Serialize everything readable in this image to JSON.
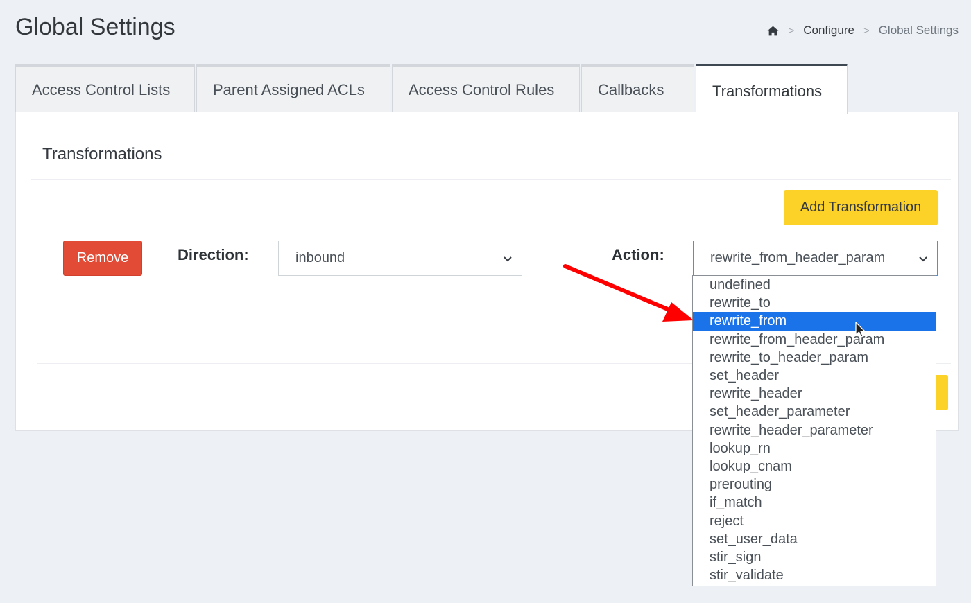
{
  "header": {
    "title": "Global Settings",
    "breadcrumb": {
      "home_icon": "home-icon",
      "items": [
        "Configure",
        "Global Settings"
      ],
      "separator": ">"
    }
  },
  "tabs": [
    {
      "label": "Access Control Lists",
      "active": false
    },
    {
      "label": "Parent Assigned ACLs",
      "active": false
    },
    {
      "label": "Access Control Rules",
      "active": false
    },
    {
      "label": "Callbacks",
      "active": false
    },
    {
      "label": "Transformations",
      "active": true
    }
  ],
  "card": {
    "title": "Transformations",
    "add_button": "Add Transformation",
    "remove_button": "Remove",
    "direction": {
      "label": "Direction:",
      "value": "inbound"
    },
    "action": {
      "label": "Action:",
      "value": "rewrite_from_header_param",
      "options": [
        "undefined",
        "rewrite_to",
        "rewrite_from",
        "rewrite_from_header_param",
        "rewrite_to_header_param",
        "set_header",
        "rewrite_header",
        "set_header_parameter",
        "rewrite_header_parameter",
        "lookup_rn",
        "lookup_cnam",
        "prerouting",
        "if_match",
        "reject",
        "set_user_data",
        "stir_sign",
        "stir_validate"
      ],
      "highlighted_option": "rewrite_from"
    }
  },
  "colors": {
    "accent_yellow": "#fcd228",
    "remove_red": "#e24c36",
    "highlight_blue": "#1a73e8",
    "annotation_arrow": "#ff0000"
  }
}
